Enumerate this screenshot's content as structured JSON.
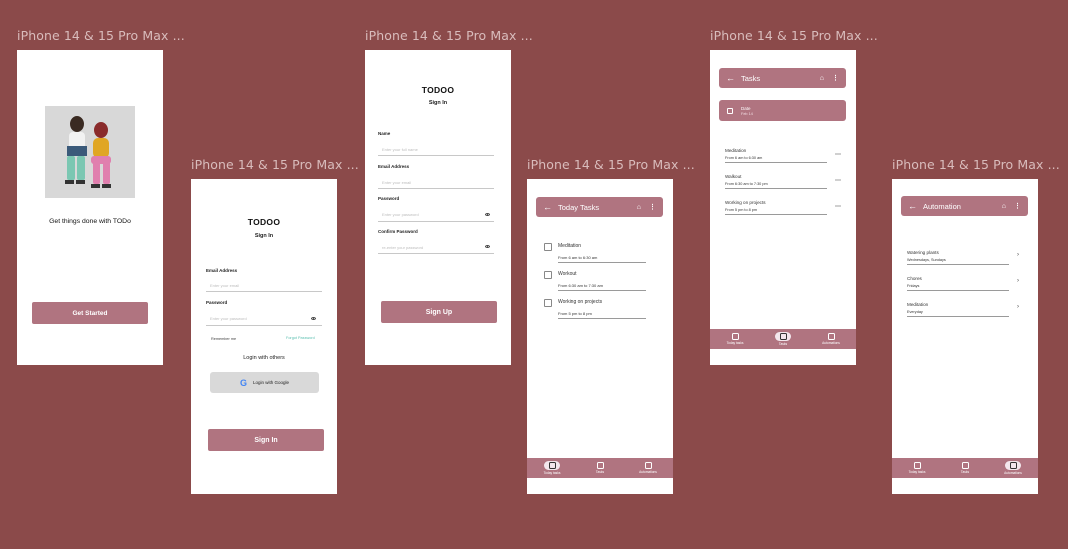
{
  "frame_label": "iPhone 14 & 15 Pro Max ...",
  "welcome": {
    "headline": "Get things done with TODo",
    "button": "Get Started"
  },
  "signin": {
    "title": "TODOO",
    "subtitle": "Sign In",
    "email_label": "Email Address",
    "email_placeholder": "Enter your email",
    "password_label": "Password",
    "password_placeholder": "Enter your password",
    "remember": "Remember me",
    "forgot": "Forgot Password",
    "login_others": "Login with others",
    "google": "Login with Google",
    "button": "Sign In"
  },
  "signup": {
    "title": "TODOO",
    "subtitle": "Sign In",
    "name_label": "Name",
    "name_placeholder": "Enter your full name",
    "email_label": "Email Address",
    "email_placeholder": "Enter your email",
    "password_label": "Password",
    "password_placeholder": "Enter your password",
    "confirm_label": "Confirm Password",
    "confirm_placeholder": "re-enter your password",
    "button": "Sign Up"
  },
  "today": {
    "title": "Today Tasks",
    "tasks": [
      {
        "name": "Meditation",
        "time": "From 6 am to 6:30 am"
      },
      {
        "name": "Workout",
        "time": "From 6:30 am to 7:30 am"
      },
      {
        "name": "Working on projects",
        "time": "From 5 pm to 8 pm"
      }
    ]
  },
  "tasks": {
    "title": "Tasks",
    "date_label": "Date",
    "date_value": "Feb 14",
    "tasks": [
      {
        "name": "Meditation",
        "time": "From 6 am to 6:30 am"
      },
      {
        "name": "Walkout",
        "time": "From 6:30 am to 7:30 pm"
      },
      {
        "name": "Working on projects",
        "time": "From 5 pm to 8 pm"
      }
    ]
  },
  "automation": {
    "title": "Automation",
    "items": [
      {
        "name": "Watering plants",
        "schedule": "Wednesdays, Sundays"
      },
      {
        "name": "Chores",
        "schedule": "Fridays"
      },
      {
        "name": "Meditation",
        "schedule": "Everyday"
      }
    ]
  },
  "nav": {
    "today": "Today tasks",
    "tasks": "Tasks",
    "automation": "Automations"
  },
  "colors": {
    "background": "#8b4a4a",
    "accent": "#b07480"
  }
}
